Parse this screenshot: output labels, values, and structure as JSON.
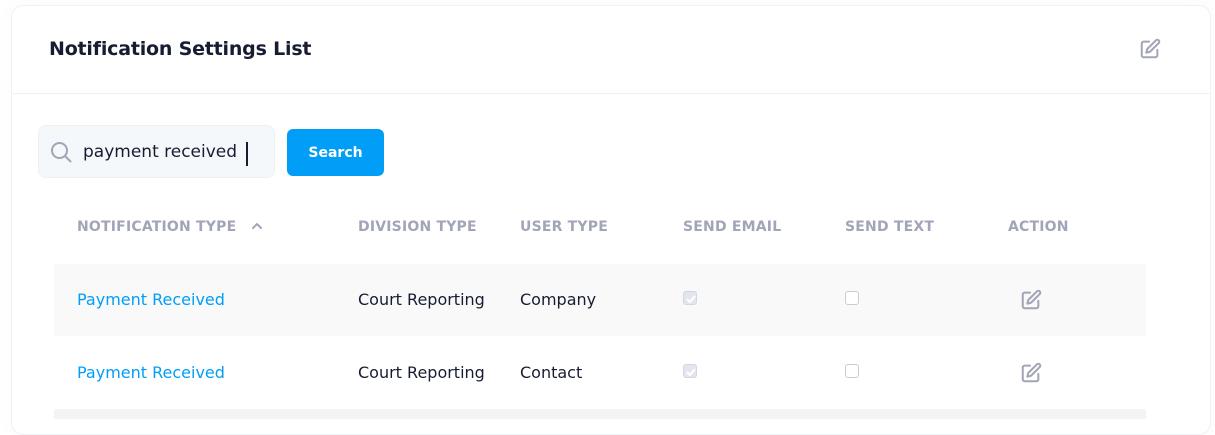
{
  "card": {
    "title": "Notification Settings List"
  },
  "search": {
    "value": "payment received",
    "button_label": "Search"
  },
  "table": {
    "columns": [
      "NOTIFICATION TYPE",
      "DIVISION TYPE",
      "USER TYPE",
      "SEND EMAIL",
      "SEND TEXT",
      "ACTION"
    ],
    "sort": {
      "column": "NOTIFICATION TYPE",
      "direction": "ascending"
    },
    "rows": [
      {
        "notification_type": "Payment Received",
        "division_type": "Court Reporting",
        "user_type": "Company",
        "send_email": true,
        "send_text": false
      },
      {
        "notification_type": "Payment Received",
        "division_type": "Court Reporting",
        "user_type": "Contact",
        "send_email": true,
        "send_text": false
      }
    ]
  },
  "colors": {
    "accent": "#009ef7",
    "header_text": "#a1a5b7",
    "title_text": "#181c32"
  },
  "icons": {
    "header_action": "edit-icon",
    "search": "search-icon",
    "sort": "chevron-up-icon",
    "row_action": "edit-icon"
  }
}
